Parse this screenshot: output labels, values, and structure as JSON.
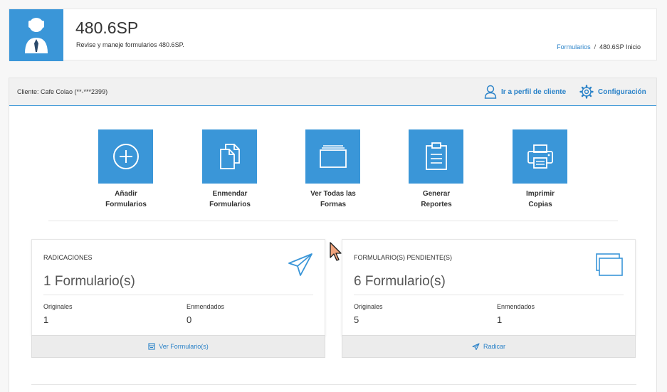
{
  "header": {
    "title": "480.6SP",
    "subtitle": "Revise y maneje formularios 480.6SP.",
    "breadcrumb": {
      "link": "Formularios",
      "separator": "/",
      "current": "480.6SP Inicio"
    }
  },
  "panel": {
    "client_label": "Cliente: Cafe Colao (**-***2399)",
    "profile_link": "Ir a perfil de cliente",
    "settings_link": "Configuración"
  },
  "tiles": [
    {
      "line1": "Añadir",
      "line2": "Formularios",
      "icon": "plus-circle-icon"
    },
    {
      "line1": "Enmendar",
      "line2": "Formularios",
      "icon": "copy-documents-icon"
    },
    {
      "line1": "Ver Todas las",
      "line2": "Formas",
      "icon": "folder-icon"
    },
    {
      "line1": "Generar",
      "line2": "Reportes",
      "icon": "clipboard-icon"
    },
    {
      "line1": "Imprimir",
      "line2": "Copias",
      "icon": "printer-icon"
    }
  ],
  "cards": [
    {
      "title": "RADICACIONES",
      "count": "1 Formulario(s)",
      "left_label": "Originales",
      "left_value": "1",
      "right_label": "Enmendados",
      "right_value": "0",
      "button": "Ver Formulario(s)",
      "icon": "paper-plane-icon"
    },
    {
      "title": "FORMULARIO(S) PENDIENTE(S)",
      "count": "6 Formulario(s)",
      "left_label": "Originales",
      "left_value": "5",
      "right_label": "Enmendados",
      "right_value": "1",
      "button": "Radicar",
      "icon": "stacked-windows-icon"
    }
  ],
  "colors": {
    "accent": "#3a96d8",
    "link": "#2a82c8",
    "bar": "#f1f1f1"
  }
}
